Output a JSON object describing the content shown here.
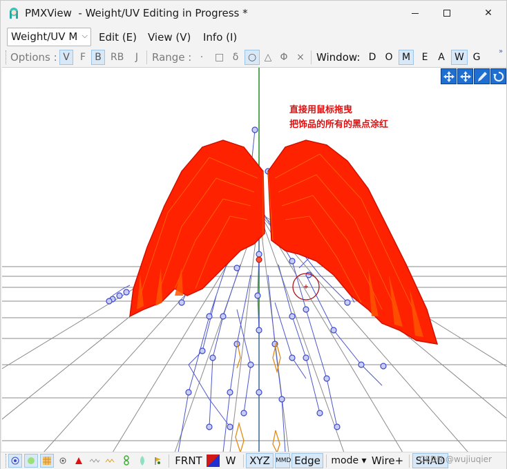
{
  "window": {
    "app_name": "PMXView",
    "title": "PMXView  - Weight/UV Editing in Progress *",
    "minimize_glyph": "—",
    "close_glyph": "✕"
  },
  "menubar": {
    "mode_select_value": "Weight/UV M",
    "items": [
      "Edit (E)",
      "View (V)",
      "Info (I)"
    ]
  },
  "options_toolbar": {
    "options_label": "Options :",
    "option_buttons": [
      {
        "label": "V",
        "active": true
      },
      {
        "label": "F",
        "active": false
      },
      {
        "label": "B",
        "active": true
      },
      {
        "label": "RB",
        "active": false
      },
      {
        "label": "J",
        "active": false
      }
    ],
    "range_label": "Range :",
    "range_buttons": [
      {
        "label": "·",
        "active": false
      },
      {
        "label": "□",
        "active": false
      },
      {
        "label": "δ",
        "active": false
      },
      {
        "label": "○",
        "active": true
      },
      {
        "label": "△",
        "active": false
      },
      {
        "label": "Φ",
        "active": false
      },
      {
        "label": "×",
        "active": false
      }
    ],
    "window_label": "Window:",
    "window_buttons": [
      {
        "label": "D",
        "active": false
      },
      {
        "label": "O",
        "active": false
      },
      {
        "label": "M",
        "active": true
      },
      {
        "label": "E",
        "active": false
      },
      {
        "label": "A",
        "active": false
      },
      {
        "label": "W",
        "active": true
      },
      {
        "label": "G",
        "active": false
      }
    ],
    "overflow_chevron": "»"
  },
  "viewport": {
    "annotation_line1": "直接用鼠标拖曳",
    "annotation_line2": "把饰品的所有的黑点涂红",
    "nav_icons": [
      "move-xy-icon",
      "move-xz-icon",
      "pick-icon",
      "rotate-view-icon"
    ]
  },
  "bottom_toolbar": {
    "icon_buttons": [
      {
        "name": "vertex-select-icon",
        "active": true
      },
      {
        "name": "weight-paint-icon",
        "active": true
      },
      {
        "name": "weight-grid-icon",
        "active": true
      },
      {
        "name": "bone-point-icon",
        "active": false
      },
      {
        "name": "red-triangle-icon",
        "active": false
      },
      {
        "name": "wave-icon",
        "active": false
      },
      {
        "name": "chain-icon",
        "active": false
      },
      {
        "name": "green-chain-icon",
        "active": false
      },
      {
        "name": "leaf-icon",
        "active": false
      },
      {
        "name": "flag-icon",
        "active": false
      }
    ],
    "frnt_label": "FRNT",
    "w_label": "W",
    "xyz_label": "XYZ",
    "mmd_label": "MMD",
    "edge_label": "Edge",
    "mode_label": "mode ▾",
    "wire_label": "Wire+",
    "shad_label": "SHAD",
    "watermark": "CSDN @wujiuqier",
    "colors": {
      "active_bg": "#d8e8f6",
      "active_border": "#9cc4e6",
      "paint": "#ff2a00",
      "bone": "#3b48c8",
      "axis_green": "#1e8a1e"
    }
  }
}
